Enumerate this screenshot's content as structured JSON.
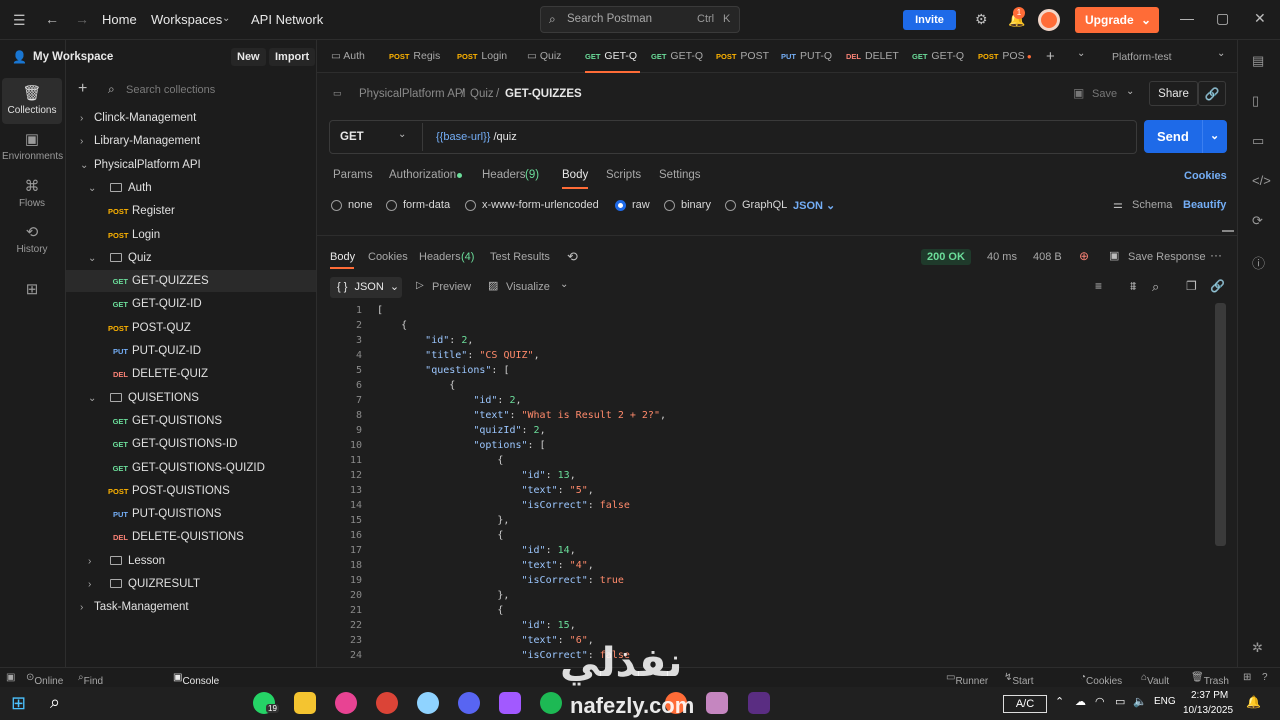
{
  "topbar": {
    "home": "Home",
    "workspaces": "Workspaces",
    "api_network": "API Network",
    "search_placeholder": "Search Postman",
    "shortcut_ctrl": "Ctrl",
    "shortcut_k": "K",
    "invite": "Invite",
    "notification_count": "1",
    "upgrade": "Upgrade"
  },
  "rail": {
    "collections": "Collections",
    "environments": "Environments",
    "flows": "Flows",
    "history": "History"
  },
  "sidebar": {
    "workspace": "My Workspace",
    "new": "New",
    "import": "Import",
    "search_placeholder": "Search collections",
    "items": [
      {
        "label": "Clinck-Management",
        "level": 0,
        "type": "collection",
        "state": "collapsed"
      },
      {
        "label": "Library-Management",
        "level": 0,
        "type": "collection",
        "state": "collapsed"
      },
      {
        "label": "PhysicalPlatform API",
        "level": 0,
        "type": "collection",
        "state": "expanded"
      },
      {
        "label": "Auth",
        "level": 1,
        "type": "folder",
        "state": "expanded"
      },
      {
        "label": "Register",
        "level": 2,
        "type": "request",
        "method": "POST"
      },
      {
        "label": "Login",
        "level": 2,
        "type": "request",
        "method": "POST"
      },
      {
        "label": "Quiz",
        "level": 1,
        "type": "folder",
        "state": "expanded"
      },
      {
        "label": "GET-QUIZZES",
        "level": 2,
        "type": "request",
        "method": "GET",
        "selected": true
      },
      {
        "label": "GET-QUIZ-ID",
        "level": 2,
        "type": "request",
        "method": "GET"
      },
      {
        "label": "POST-QUZ",
        "level": 2,
        "type": "request",
        "method": "POST"
      },
      {
        "label": "PUT-QUIZ-ID",
        "level": 2,
        "type": "request",
        "method": "PUT"
      },
      {
        "label": "DELETE-QUIZ",
        "level": 2,
        "type": "request",
        "method": "DEL"
      },
      {
        "label": "QUISETIONS",
        "level": 1,
        "type": "folder",
        "state": "expanded"
      },
      {
        "label": "GET-QUISTIONS",
        "level": 2,
        "type": "request",
        "method": "GET"
      },
      {
        "label": "GET-QUISTIONS-ID",
        "level": 2,
        "type": "request",
        "method": "GET"
      },
      {
        "label": "GET-QUISTIONS-QUIZID",
        "level": 2,
        "type": "request",
        "method": "GET"
      },
      {
        "label": "POST-QUISTIONS",
        "level": 2,
        "type": "request",
        "method": "POST"
      },
      {
        "label": "PUT-QUISTIONS",
        "level": 2,
        "type": "request",
        "method": "PUT"
      },
      {
        "label": "DELETE-QUISTIONS",
        "level": 2,
        "type": "request",
        "method": "DEL"
      },
      {
        "label": "Lesson",
        "level": 1,
        "type": "folder",
        "state": "collapsed"
      },
      {
        "label": "QUIZRESULT",
        "level": 1,
        "type": "folder",
        "state": "collapsed"
      },
      {
        "label": "Task-Management",
        "level": 0,
        "type": "collection",
        "state": "collapsed"
      }
    ]
  },
  "tabs": [
    {
      "method": "",
      "label": "Auth"
    },
    {
      "method": "POST",
      "label": "Regis"
    },
    {
      "method": "POST",
      "label": "Login"
    },
    {
      "method": "",
      "label": "Quiz"
    },
    {
      "method": "GET",
      "label": "GET-Q",
      "active": true
    },
    {
      "method": "GET",
      "label": "GET-Q"
    },
    {
      "method": "POST",
      "label": "POST"
    },
    {
      "method": "PUT",
      "label": "PUT-Q"
    },
    {
      "method": "DEL",
      "label": "DELET"
    },
    {
      "method": "GET",
      "label": "GET-Q"
    },
    {
      "method": "POST",
      "label": "POS"
    }
  ],
  "environment": "Platform-test",
  "breadcrumb": {
    "collection": "PhysicalPlatform API",
    "folder": "Quiz",
    "request": "GET-QUIZZES"
  },
  "actions": {
    "save": "Save",
    "share": "Share"
  },
  "request": {
    "method": "GET",
    "url_var": "{{base-url}}",
    "url_path": " /quiz",
    "send": "Send"
  },
  "request_tabs": [
    "Params",
    "Authorization",
    "Headers",
    "Body",
    "Scripts",
    "Settings"
  ],
  "headers_count": "(9)",
  "cookies_link": "Cookies",
  "body_types": [
    "none",
    "form-data",
    "x-www-form-urlencoded",
    "raw",
    "binary",
    "GraphQL"
  ],
  "raw_format": "JSON",
  "schema": "Schema",
  "beautify": "Beautify",
  "response": {
    "tabs": [
      "Body",
      "Cookies",
      "Headers",
      "Test Results"
    ],
    "headers_count": "(4)",
    "status": "200 OK",
    "time": "40 ms",
    "size": "408 B",
    "save_response": "Save Response",
    "format": "JSON",
    "preview": "Preview",
    "visualize": "Visualize"
  },
  "code_lines": [
    "[",
    "    {",
    "        \"id\": 2,",
    "        \"title\": \"CS QUIZ\",",
    "        \"questions\": [",
    "            {",
    "                \"id\": 2,",
    "                \"text\": \"What is Result 2 + 2?\",",
    "                \"quizId\": 2,",
    "                \"options\": [",
    "                    {",
    "                        \"id\": 13,",
    "                        \"text\": \"5\",",
    "                        \"isCorrect\": false",
    "                    },",
    "                    {",
    "                        \"id\": 14,",
    "                        \"text\": \"4\",",
    "                        \"isCorrect\": true",
    "                    },",
    "                    {",
    "                        \"id\": 15,",
    "                        \"text\": \"6\",",
    "                        \"isCorrect\": false"
  ],
  "statusbar": {
    "online": "Online",
    "find": "Find and replace",
    "console": "Console",
    "runner": "Runner",
    "proxy": "Start Proxy",
    "cookies": "Cookies",
    "vault": "Vault",
    "trash": "Trash"
  },
  "taskbar": {
    "ac": "A/C",
    "lang": "ENG",
    "time": "2:37 PM",
    "date": "10/13/2025",
    "whatsapp_badge": "19"
  },
  "watermark": {
    "arabic": "نفذلي",
    "latin": "nafezly.com"
  },
  "colors": {
    "accent": "#ff6c37",
    "primary": "#1e6ae8",
    "get": "#6bdd9a",
    "post": "#ffb400",
    "put": "#74aef6",
    "delete": "#f78175"
  }
}
